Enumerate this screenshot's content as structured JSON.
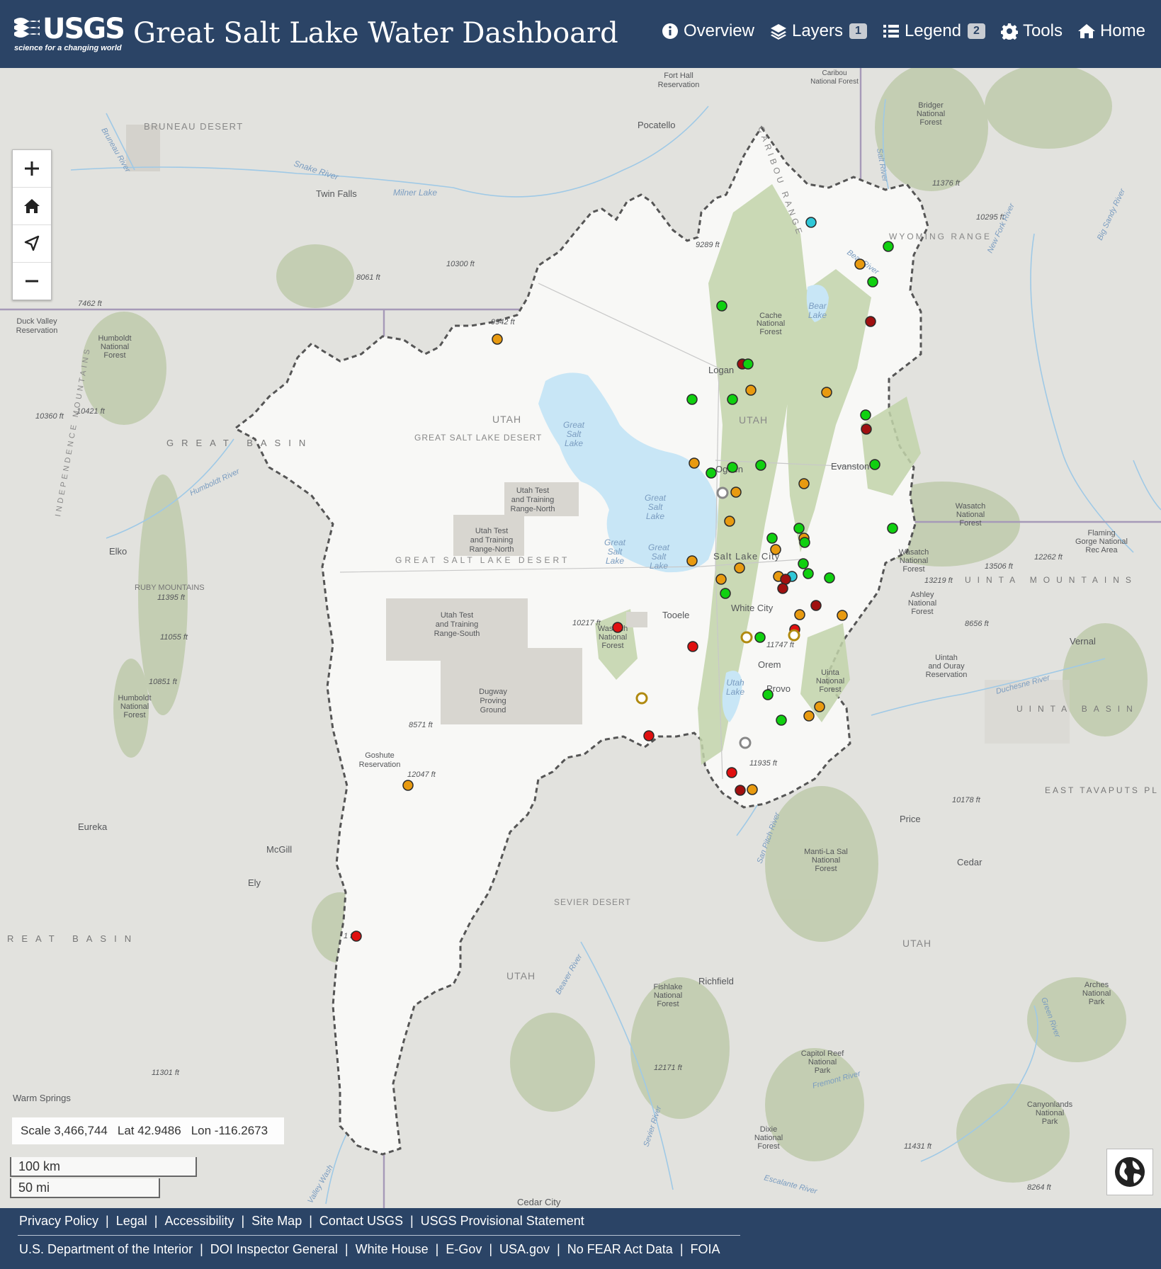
{
  "header": {
    "logo_text": "USGS",
    "logo_tagline": "science for a changing world",
    "title": "Great Salt Lake Water Dashboard",
    "nav": [
      {
        "icon": "info-icon",
        "label": "Overview",
        "badge": ""
      },
      {
        "icon": "layers-icon",
        "label": "Layers",
        "badge": "1"
      },
      {
        "icon": "list-icon",
        "label": "Legend",
        "badge": "2"
      },
      {
        "icon": "gear-icon",
        "label": "Tools",
        "badge": ""
      },
      {
        "icon": "home-icon",
        "label": "Home",
        "badge": ""
      }
    ]
  },
  "map": {
    "zoom_controls": [
      {
        "name": "zoom-in-button",
        "icon": "plus-icon"
      },
      {
        "name": "default-extent-button",
        "icon": "home-icon"
      },
      {
        "name": "locate-button",
        "icon": "locate-arrow-icon"
      },
      {
        "name": "zoom-out-button",
        "icon": "minus-icon"
      }
    ],
    "coordinates": {
      "scale": "Scale 3,466,744",
      "lat": "Lat 42.9486",
      "lon": "Lon -116.2673"
    },
    "scale_bar": {
      "km": "100 km",
      "mi": "50 mi"
    },
    "basemap_toggle_icon": "globe-icon",
    "status_colors": {
      "green": "#10d010",
      "orange": "#e89a10",
      "red": "#e01010",
      "dark_red": "#a01010",
      "cyan": "#30c8d8",
      "hollow_gray": "#888888",
      "hollow_olive": "#b08a10"
    },
    "labels": [
      "BRUNEAU DESERT",
      "Bruneau River",
      "Snake River",
      "Twin Falls",
      "Milner Lake",
      "Pocatello",
      "Fort Hall Reservation",
      "Caribou National Forest",
      "Bridger National Forest",
      "Salt River",
      "11376 ft",
      "10295 ft",
      "WYOMING RANGE",
      "New Fork River",
      "Big Sandy River",
      "Bear River",
      "9289 ft",
      "10300 ft",
      "8061 ft",
      "7462 ft",
      "Duck Valley Reservation",
      "Humboldt National Forest",
      "9942 ft",
      "Cache National Forest",
      "Bear Lake",
      "Logan",
      "UTAH",
      "GREAT SALT LAKE DESERT",
      "Great Salt Lake",
      "10360 ft",
      "10421 ft",
      "GREAT BASIN",
      "Humboldt River",
      "INDEPENDENCE MOUNTAINS",
      "Evanston",
      "Ogden",
      "Utah Test and Training Range-North",
      "Wasatch National Forest",
      "Flaming Gorge National Rec Area",
      "Elko",
      "Salt Lake City",
      "13506 ft",
      "12262 ft",
      "13219 ft",
      "UINTA MOUNTAINS",
      "RUBY MOUNTAINS",
      "11395 ft",
      "Utah Test and Training Range-South",
      "10217 ft",
      "Wasatch National Forest",
      "Tooele",
      "White City",
      "Ashley National Forest",
      "8656 ft",
      "Vernal",
      "11055 ft",
      "11747 ft",
      "Orem",
      "Uinta National Forest",
      "Uintah and Ouray Reservation",
      "Duchesne River",
      "10851 ft",
      "Dugway Proving Ground",
      "Utah Lake",
      "Provo",
      "UINTA BASIN",
      "8571 ft",
      "Goshute Reservation",
      "12047 ft",
      "11935 ft",
      "EAST TAVAPUTS PL",
      "10178 ft",
      "Eureka",
      "Price",
      "McGill",
      "Manti-La Sal National Forest",
      "Cedar",
      "San Pitch River",
      "Ely",
      "SEVIER DESERT",
      "UTAH",
      "Richfield",
      "Beaver River",
      "Fishlake National Forest",
      "Arches National Park",
      "Green River",
      "REAT BASIN",
      "11301 ft",
      "12171 ft",
      "Capitol Reef National Park",
      "Fremont River",
      "Canyonlands National Park",
      "Warm Springs",
      "Sevier River",
      "Dixie National Forest",
      "11431 ft",
      "Escalante River",
      "8264 ft",
      "Cedar City",
      "Valley Wash",
      "Great Salt Lake"
    ]
  },
  "footer": {
    "row1": [
      "Privacy Policy",
      "Legal",
      "Accessibility",
      "Site Map",
      "Contact USGS",
      "USGS Provisional Statement"
    ],
    "row2": [
      "U.S. Department of the Interior",
      "DOI Inspector General",
      "White House",
      "E-Gov",
      "USA.gov",
      "No FEAR Act Data",
      "FOIA"
    ]
  }
}
